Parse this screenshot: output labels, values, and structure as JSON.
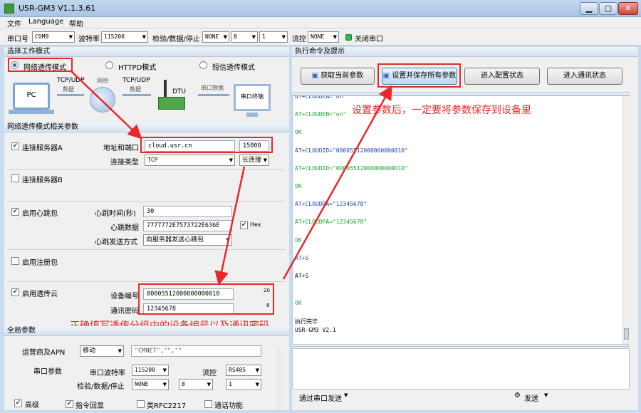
{
  "window": {
    "title": "USR-GM3 V1.1.3.61"
  },
  "menu": [
    "文件",
    "Language",
    "帮助"
  ],
  "toolbar": {
    "port_label": "串口号",
    "port_value": "COM9",
    "baud_label": "波特率",
    "baud_value": "115200",
    "parity_label": "检验/数据/停止",
    "parity_value": "NONE",
    "data_bits": "8",
    "stop_bits": "1",
    "flow_label": "流控",
    "flow_value": "NONE",
    "close_port": "关闭串口"
  },
  "mode_section": {
    "title": "选择工作模式",
    "modes": [
      {
        "label": "网络透传模式",
        "selected": true
      },
      {
        "label": "HTTPD模式",
        "selected": false
      },
      {
        "label": "短信透传模式",
        "selected": false
      }
    ]
  },
  "diagram": {
    "pc": "PC",
    "tcpudp1": "TCP/UDP",
    "data1": "数据",
    "network": "网络",
    "tcpudp2": "TCP/UDP",
    "data2": "数据",
    "dtu": "DTU",
    "serial_data": "串口数据",
    "terminal": "串口终端"
  },
  "net_params": {
    "title": "网络透传模式相关参数",
    "server_a": {
      "label": "连接服务器A",
      "checked": true,
      "addr_label": "地址和端口",
      "address": "cloud.usr.cn",
      "port": "15000",
      "type_label": "连接类型",
      "type_value": "TCP",
      "conn_mode": "长连接"
    },
    "server_b": {
      "label": "连接服务器B",
      "checked": false
    },
    "heartbeat": {
      "label": "启用心跳包",
      "checked": true,
      "time_label": "心跳时间(秒)",
      "time_value": "30",
      "data_label": "心跳数据",
      "data_value": "7777772E7573722E636E",
      "hex_label": "Hex",
      "hex_checked": true,
      "send_label": "心跳发送方式",
      "send_value": "向服务器发送心跳包"
    },
    "register": {
      "label": "启用注册包",
      "checked": false
    },
    "cloud": {
      "label": "启用透传云",
      "checked": true,
      "dev_label": "设备编号",
      "dev_value": "00005512000000000010",
      "dev_count": "20",
      "pwd_label": "通讯密码",
      "pwd_value": "12345678",
      "pwd_count": "8"
    }
  },
  "global": {
    "title": "全局参数",
    "apn_label": "运营商及APN",
    "apn_operator": "移动",
    "apn_value": "\"CMNET\",\"\",\"\"",
    "serial_label": "串口参数",
    "baud_label": "串口波特率",
    "baud_value": "115200",
    "flow_label": "流控",
    "flow_value": "RS485",
    "parity_label": "检验/数据/停止",
    "parity_value": "NONE",
    "data_bits": "8",
    "stop_bits": "1",
    "advanced_label": "高级",
    "echo_label": "指令回显",
    "rfc_label": "类RFC2217",
    "comm_label": "通话功能"
  },
  "commands": {
    "title": "执行命令及提示",
    "buttons": [
      "获取当前参数",
      "设置并保存所有参数",
      "进入配置状态",
      "进入通讯状态"
    ]
  },
  "log": [
    {
      "text": "AT+CLOUDEN=\"on\"",
      "color": "blue"
    },
    {
      "text": "",
      "color": "blue"
    },
    {
      "text": "AT+CLOUDEN=\"on\"",
      "color": "green"
    },
    {
      "text": "",
      "color": "green"
    },
    {
      "text": "OK",
      "color": "green"
    },
    {
      "text": "",
      "color": "green"
    },
    {
      "text": "AT+CLOUDID=\"00005512000000000010\"",
      "color": "blue"
    },
    {
      "text": "",
      "color": "blue"
    },
    {
      "text": "AT+CLOUDID=\"00005512000000000010\"",
      "color": "green"
    },
    {
      "text": "",
      "color": "green"
    },
    {
      "text": "OK",
      "color": "green"
    },
    {
      "text": "",
      "color": "green"
    },
    {
      "text": "AT+CLOUDPA=\"12345678\"",
      "color": "blue"
    },
    {
      "text": "",
      "color": "blue"
    },
    {
      "text": "AT+CLOUDPA=\"12345678\"",
      "color": "green"
    },
    {
      "text": "",
      "color": "green"
    },
    {
      "text": "OK",
      "color": "green"
    },
    {
      "text": "",
      "color": "green"
    },
    {
      "text": "AT+S",
      "color": "blue"
    },
    {
      "text": "",
      "color": "blue"
    },
    {
      "text": "AT+S",
      "color": "black"
    },
    {
      "text": "",
      "color": "black"
    },
    {
      "text": "",
      "color": "black"
    },
    {
      "text": "OK",
      "color": "green"
    },
    {
      "text": "",
      "color": "black"
    },
    {
      "text": "执行完毕",
      "color": "black"
    },
    {
      "text": "USR-GM3 V2.1",
      "color": "black"
    }
  ],
  "send": {
    "via_label": "通过串口发送",
    "send_label": "发送"
  },
  "annotations": {
    "save_note": "设置参数后，一定要将参数保存到设备里",
    "fill_note": "正确填写透传分组中的设备编号以及通讯密码"
  },
  "colors": {
    "annotation": "#e62a2a",
    "log_blue": "#1e46b8",
    "log_green": "#17a52a"
  }
}
